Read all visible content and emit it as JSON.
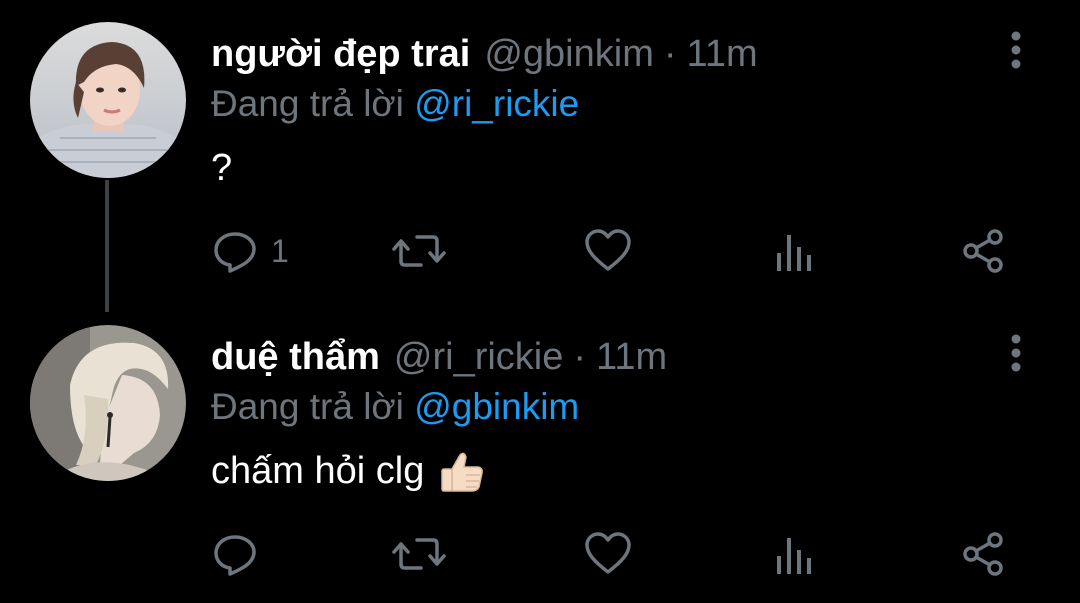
{
  "colors": {
    "background": "#000000",
    "primary_text": "#ffffff",
    "secondary_text": "#6e767d",
    "mention": "#1d9bf0",
    "thread_line": "#3d4145"
  },
  "tweets": [
    {
      "display_name": "người đẹp trai",
      "handle": "@gbinkim",
      "separator": "·",
      "time": "11m",
      "reply_prefix": "Đang trả lời ",
      "reply_mention": "@ri_rickie",
      "text": "?",
      "emoji": "",
      "avatar_icon": "avatar-photo",
      "actions": {
        "reply_icon": "reply-icon",
        "reply_count": "1",
        "retweet_icon": "retweet-icon",
        "like_icon": "heart-icon",
        "stats_icon": "analytics-icon",
        "share_icon": "share-icon"
      }
    },
    {
      "display_name": "duệ thẩm",
      "handle": "@ri_rickie",
      "separator": "·",
      "time": "11m",
      "reply_prefix": "Đang trả lời ",
      "reply_mention": "@gbinkim",
      "text": "chấm hỏi clg",
      "emoji": "thumbs-up",
      "avatar_icon": "avatar-photo",
      "actions": {
        "reply_icon": "reply-icon",
        "reply_count": "",
        "retweet_icon": "retweet-icon",
        "like_icon": "heart-icon",
        "stats_icon": "analytics-icon",
        "share_icon": "share-icon"
      }
    }
  ]
}
